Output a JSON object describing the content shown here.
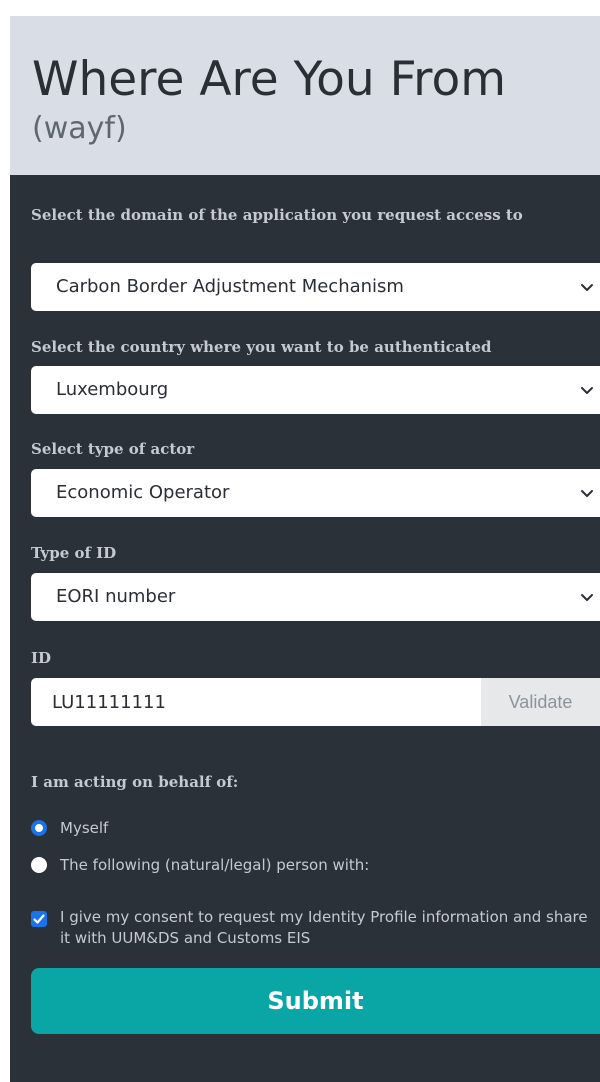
{
  "header": {
    "title": "Where Are You From",
    "subtitle": "(wayf)"
  },
  "form": {
    "domain": {
      "label": "Select the domain of the application you request access to",
      "value": "Carbon Border Adjustment Mechanism"
    },
    "country": {
      "label": "Select the country where you want to be authenticated",
      "value": "Luxembourg"
    },
    "actor": {
      "label": "Select type of actor",
      "value": "Economic Operator"
    },
    "id_type": {
      "label": "Type of ID",
      "value": "EORI number"
    },
    "id": {
      "label": "ID",
      "value": "LU11111111",
      "validate_label": "Validate"
    },
    "behalf": {
      "label": "I am acting on behalf of:",
      "options": [
        {
          "label": "Myself",
          "selected": true
        },
        {
          "label": "The following (natural/legal) person with:",
          "selected": false
        }
      ]
    },
    "consent": {
      "label": "I give my consent to request my Identity Profile information and share it with UUM&DS and Customs EIS",
      "checked": true
    },
    "submit_label": "Submit"
  },
  "icons": {
    "chevron": "chevron-down-icon",
    "check": "checkmark-icon"
  },
  "colors": {
    "header_bg": "#d9dee6",
    "panel_bg": "#2b3138",
    "accent": "#1a73e8",
    "submit": "#0aa6a6"
  }
}
